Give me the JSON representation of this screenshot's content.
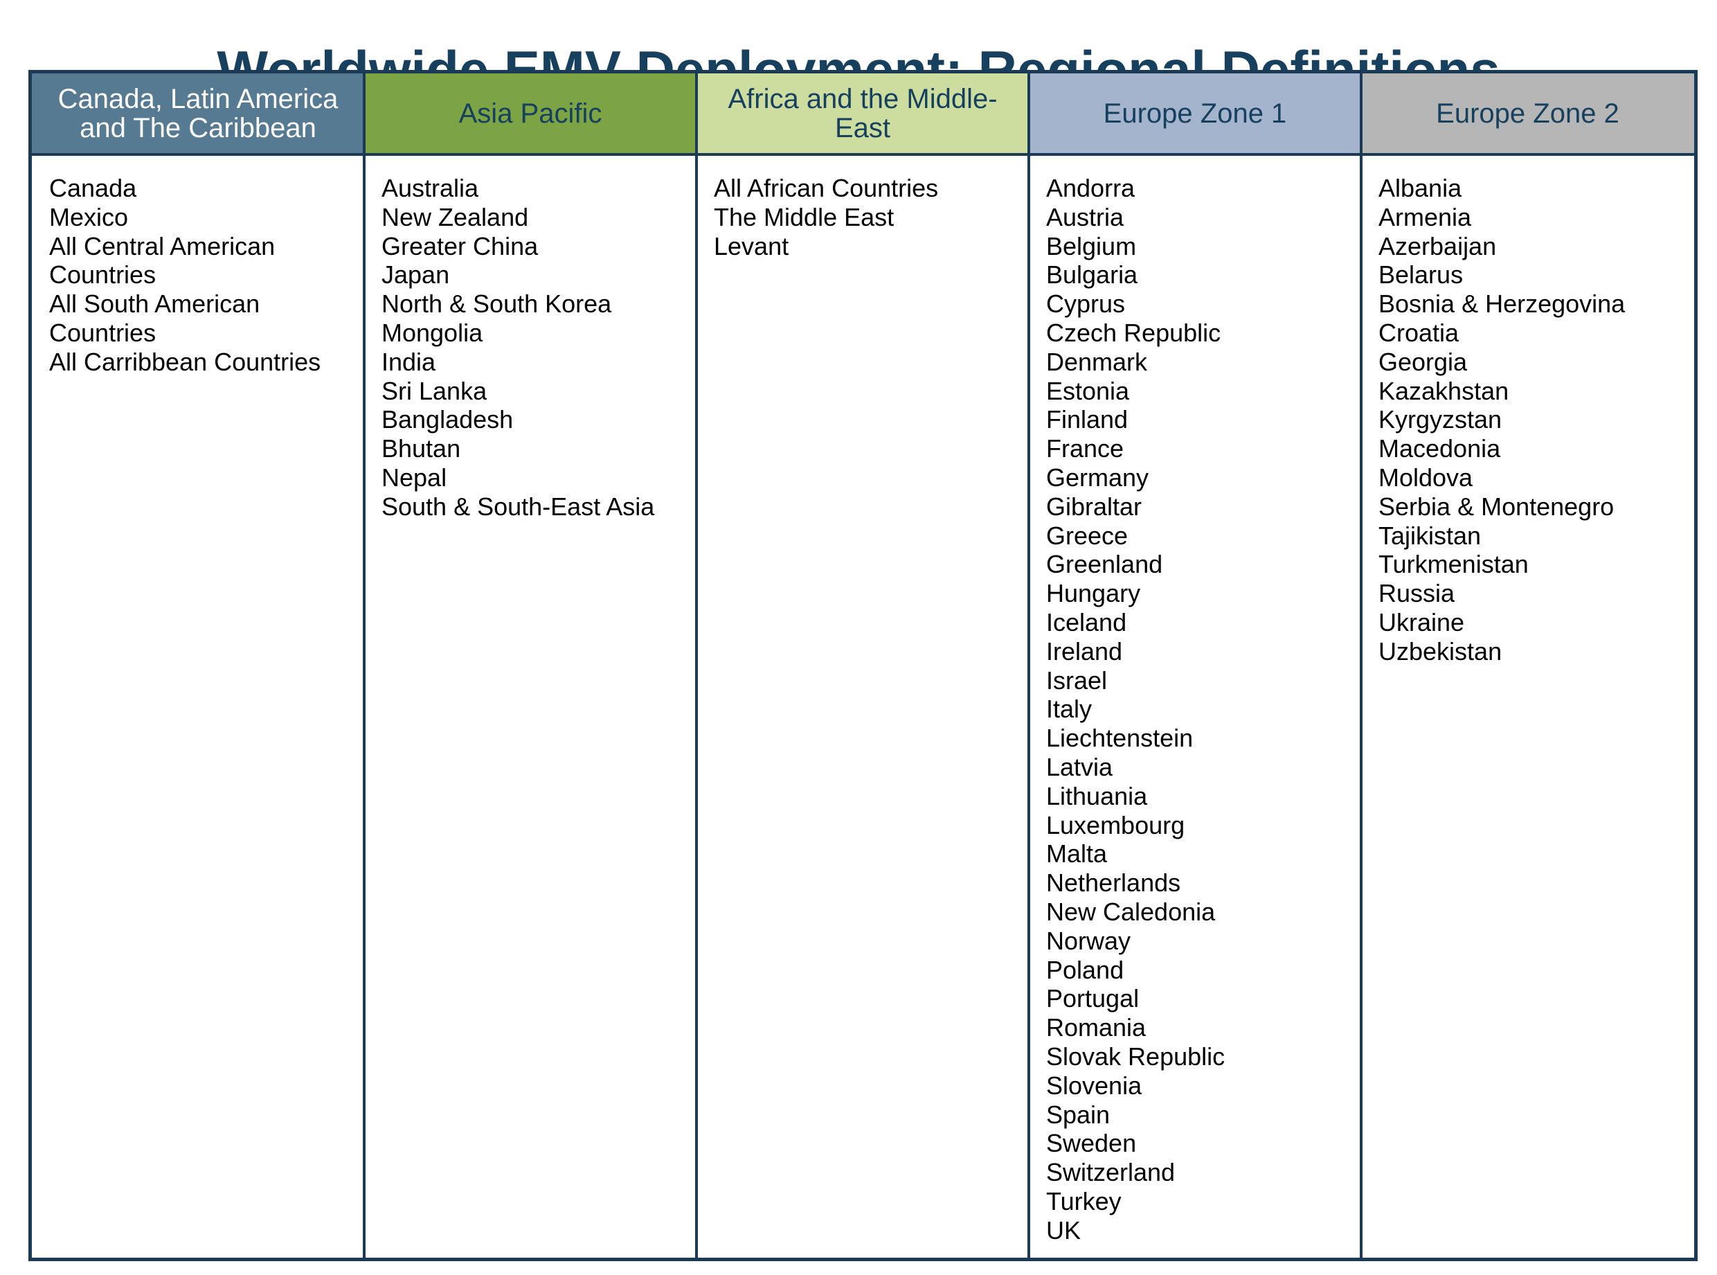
{
  "title": "Worldwide EMV Deployment: Regional Definitions",
  "colors": {
    "title_text": "#17405f",
    "border": "#1a3a55"
  },
  "regions": [
    {
      "header": "Canada, Latin America and The Caribbean",
      "header_bg": "#557a92",
      "header_text": "#ffffff",
      "countries": [
        "Canada",
        "Mexico",
        "All Central American",
        "Countries",
        "All South American",
        "Countries",
        "All Carribbean Countries"
      ]
    },
    {
      "header": "Asia Pacific",
      "header_bg": "#7da444",
      "header_text": "#17405f",
      "countries": [
        "Australia",
        "New Zealand",
        "Greater China",
        "Japan",
        "North & South Korea",
        "Mongolia",
        "India",
        "Sri Lanka",
        "Bangladesh",
        "Bhutan",
        "Nepal",
        "South & South-East Asia"
      ]
    },
    {
      "header": "Africa and the Middle-East",
      "header_bg": "#cddd9f",
      "header_text": "#17405f",
      "countries": [
        "All African Countries",
        "The Middle East",
        "Levant"
      ]
    },
    {
      "header": "Europe Zone 1",
      "header_bg": "#a5b4cd",
      "header_text": "#17405f",
      "countries": [
        "Andorra",
        "Austria",
        "Belgium",
        "Bulgaria",
        "Cyprus",
        "Czech Republic",
        "Denmark",
        "Estonia",
        "Finland",
        "France",
        "Germany",
        "Gibraltar",
        "Greece",
        "Greenland",
        "Hungary",
        "Iceland",
        "Ireland",
        "Israel",
        "Italy",
        "Liechtenstein",
        "Latvia",
        "Lithuania",
        "Luxembourg",
        "Malta",
        "Netherlands",
        "New Caledonia",
        "Norway",
        "Poland",
        "Portugal",
        "Romania",
        "Slovak Republic",
        "Slovenia",
        "Spain",
        "Sweden",
        "Switzerland",
        "Turkey",
        "UK"
      ]
    },
    {
      "header": "Europe Zone 2",
      "header_bg": "#b6b6b6",
      "header_text": "#17405f",
      "countries": [
        "Albania",
        "Armenia",
        "Azerbaijan",
        "Belarus",
        "Bosnia & Herzegovina",
        "Croatia",
        "Georgia",
        "Kazakhstan",
        "Kyrgyzstan",
        "Macedonia",
        "Moldova",
        "Serbia & Montenegro",
        "Tajikistan",
        "Turkmenistan",
        "Russia",
        "Ukraine",
        "Uzbekistan"
      ]
    }
  ]
}
